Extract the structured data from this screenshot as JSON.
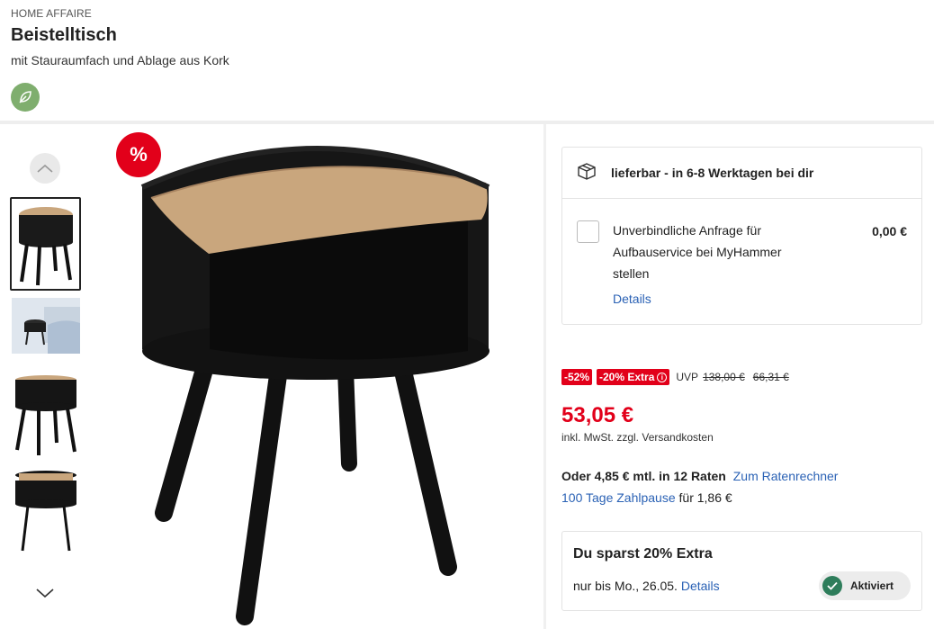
{
  "header": {
    "brand": "HOME AFFAIRE",
    "title": "Beistelltisch",
    "subtitle": "mit Stauraumfach und Ablage aus Kork"
  },
  "gallery": {
    "sale_badge": "%",
    "thumbnails": [
      "Beistelltisch Vorderansicht",
      "Beistelltisch im Raum",
      "Beistelltisch Seitenansicht",
      "Beistelltisch Detail"
    ]
  },
  "delivery": {
    "status": "lieferbar - in 6-8 Werktagen bei dir"
  },
  "service": {
    "text": "Unverbindliche Anfrage für Aufbauservice bei MyHammer stellen",
    "price": "0,00 €",
    "details_link": "Details"
  },
  "pricing": {
    "discount_tag": "-52%",
    "extra_tag": "-20% Extra",
    "extra_info_icon": "i",
    "uvp_label": "UVP",
    "uvp_price": "138,00 €",
    "old_price": "66,31 €",
    "price": "53,05 €",
    "tax_note": "inkl. MwSt. zzgl. Versandkosten"
  },
  "financing": {
    "rates_text": "Oder 4,85 € mtl. in 12 Raten",
    "rates_link": "Zum Ratenrechner",
    "pause_link": "100 Tage Zahlpause",
    "pause_text": " für 1,86 €"
  },
  "extra": {
    "title": "Du sparst 20% Extra",
    "until": "nur bis Mo., 26.05.",
    "details_link": "Details",
    "activated_label": "Aktiviert"
  },
  "colors": {
    "sale_red": "#e2001a",
    "link_blue": "#2b62b5",
    "eco_green": "#7fae6e",
    "check_green": "#2e7d5b"
  }
}
